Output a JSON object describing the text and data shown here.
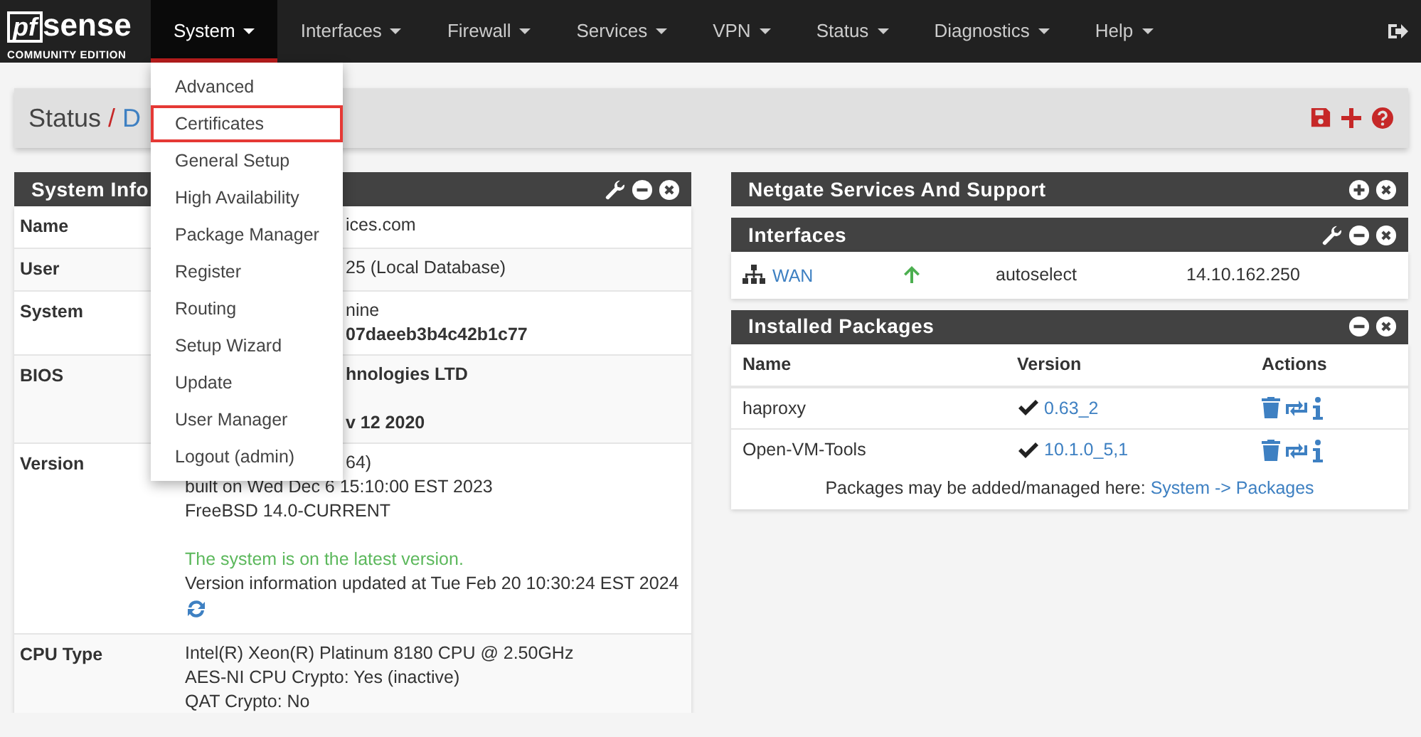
{
  "brand": {
    "prefix": "pf",
    "name": "sense",
    "edition": "COMMUNITY EDITION"
  },
  "nav": [
    {
      "label": "System",
      "selected": true
    },
    {
      "label": "Interfaces",
      "selected": false
    },
    {
      "label": "Firewall",
      "selected": false
    },
    {
      "label": "Services",
      "selected": false
    },
    {
      "label": "VPN",
      "selected": false
    },
    {
      "label": "Status",
      "selected": false
    },
    {
      "label": "Diagnostics",
      "selected": false
    },
    {
      "label": "Help",
      "selected": false
    }
  ],
  "system_menu": [
    {
      "label": "Advanced",
      "highlighted": false
    },
    {
      "label": "Certificates",
      "highlighted": true
    },
    {
      "label": "General Setup",
      "highlighted": false
    },
    {
      "label": "High Availability",
      "highlighted": false
    },
    {
      "label": "Package Manager",
      "highlighted": false
    },
    {
      "label": "Register",
      "highlighted": false
    },
    {
      "label": "Routing",
      "highlighted": false
    },
    {
      "label": "Setup Wizard",
      "highlighted": false
    },
    {
      "label": "Update",
      "highlighted": false
    },
    {
      "label": "User Manager",
      "highlighted": false
    },
    {
      "label": "Logout (admin)",
      "highlighted": false
    }
  ],
  "breadcrumb": [
    "Status",
    "D"
  ],
  "breadcrumb_separator": "/",
  "system_info": {
    "title": "System Info",
    "rows": [
      {
        "label": "Name",
        "lines": [
          {
            "text": "ices.com",
            "kind": "covered",
            "bold": false
          }
        ]
      },
      {
        "label": "User",
        "lines": [
          {
            "text": "25 (Local Database)",
            "kind": "covered",
            "bold": false
          }
        ]
      },
      {
        "label": "System",
        "lines": [
          {
            "text": "nine",
            "kind": "covered",
            "bold": false
          },
          {
            "text": "07daeeb3b4c42b1c77",
            "kind": "covered",
            "bold": true
          }
        ]
      },
      {
        "label": "BIOS",
        "lines": [
          {
            "text": "hnologies LTD",
            "kind": "covered",
            "bold": true
          },
          {
            "text": "v 12 2020",
            "kind": "covered-spaced",
            "bold": true
          }
        ]
      },
      {
        "label": "Version",
        "lines": [
          {
            "text": "64)",
            "kind": "covered",
            "bold": false
          },
          {
            "text": "built on Wed Dec 6 15:10:00 EST 2023",
            "kind": "plain",
            "bold": false
          },
          {
            "text": "FreeBSD 14.0-CURRENT",
            "kind": "plain",
            "bold": false
          },
          {
            "text": "The system is on the latest version.",
            "kind": "status",
            "bold": false
          },
          {
            "text": "Version information updated at Tue Feb 20 10:30:24 EST 2024",
            "kind": "plain",
            "bold": false
          },
          {
            "kind": "refresh"
          }
        ]
      },
      {
        "label": "CPU Type",
        "lines": [
          {
            "text": "Intel(R) Xeon(R) Platinum 8180 CPU @ 2.50GHz",
            "kind": "plain",
            "bold": false
          },
          {
            "text": "AES-NI CPU Crypto: Yes (inactive)",
            "kind": "plain",
            "bold": false
          },
          {
            "text": "QAT Crypto: No",
            "kind": "plain",
            "bold": false
          }
        ]
      }
    ]
  },
  "netgate_panel": {
    "title": "Netgate Services And Support",
    "collapsed": true
  },
  "interfaces": {
    "title": "Interfaces",
    "rows": [
      {
        "name": "WAN",
        "up": true,
        "media": "autoselect",
        "address": "14.10.162.250"
      }
    ]
  },
  "packages": {
    "title": "Installed Packages",
    "columns": [
      "Name",
      "Version",
      "Actions"
    ],
    "rows": [
      {
        "name": "haproxy",
        "version": "0.63_2"
      },
      {
        "name": "Open-VM-Tools",
        "version": "10.1.0_5,1"
      }
    ],
    "footer": "Packages may be added/managed here: ",
    "footer_link": "System -> Packages"
  }
}
